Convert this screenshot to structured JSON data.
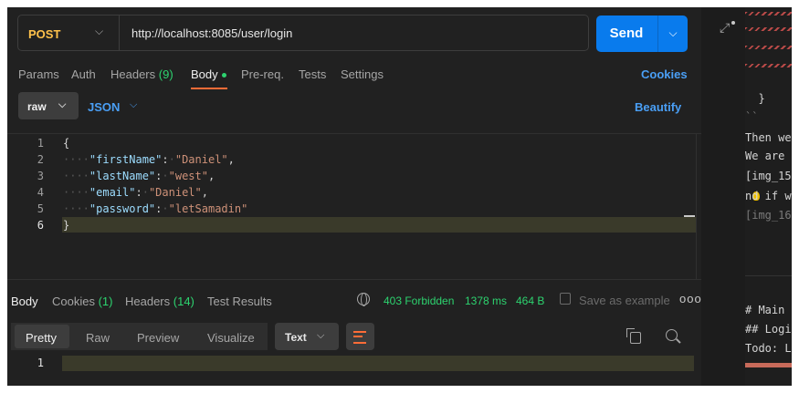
{
  "request": {
    "method": "POST",
    "url": "http://localhost:8085/user/login",
    "send_label": "Send"
  },
  "tabs": [
    {
      "label": "Params"
    },
    {
      "label": "Auth"
    },
    {
      "label": "Headers",
      "count": "(9)"
    },
    {
      "label": "Body",
      "active": true
    },
    {
      "label": "Pre-req."
    },
    {
      "label": "Tests"
    },
    {
      "label": "Settings"
    }
  ],
  "cookies_label": "Cookies",
  "body_options": {
    "mode": "raw",
    "language": "JSON",
    "beautify_label": "Beautify"
  },
  "editor": {
    "line_numbers": [
      "1",
      "2",
      "3",
      "4",
      "5",
      "6"
    ],
    "lines": [
      {
        "open": "{"
      },
      {
        "key": "\"firstName\"",
        "value": "\"Daniel\"",
        "comma": ","
      },
      {
        "key": "\"lastName\"",
        "value": "\"west\"",
        "comma": ","
      },
      {
        "key": "\"email\"",
        "value": "\"Daniel\"",
        "comma": ","
      },
      {
        "key": "\"password\"",
        "value": "\"letSamadin\"",
        "comma": ""
      },
      {
        "close": "}"
      }
    ]
  },
  "response": {
    "tabs": [
      {
        "label": "Body",
        "active": true
      },
      {
        "label": "Cookies",
        "count": "(1)"
      },
      {
        "label": "Headers",
        "count": "(14)"
      },
      {
        "label": "Test Results"
      }
    ],
    "status": "403 Forbidden",
    "time": "1378 ms",
    "size": "464 B",
    "save_label": "Save as example",
    "more_label": "ooo",
    "formats": [
      "Pretty",
      "Raw",
      "Preview",
      "Visualize"
    ],
    "type": "Text",
    "line_numbers": [
      "1"
    ]
  },
  "right_pane": {
    "lines": [
      "  }",
      "``",
      "Then we",
      "We are a",
      "[img_15",
      "nd if w",
      "[img_16",
      "# Main",
      "## Logi",
      "Todo: Lo"
    ]
  },
  "colors": {
    "accent_blue": "#097bed",
    "link_blue": "#4a9ff5",
    "method_yellow": "#ffc24b",
    "success_green": "#2dd36f",
    "tab_underline": "#ff6c37",
    "background": "#212121"
  }
}
